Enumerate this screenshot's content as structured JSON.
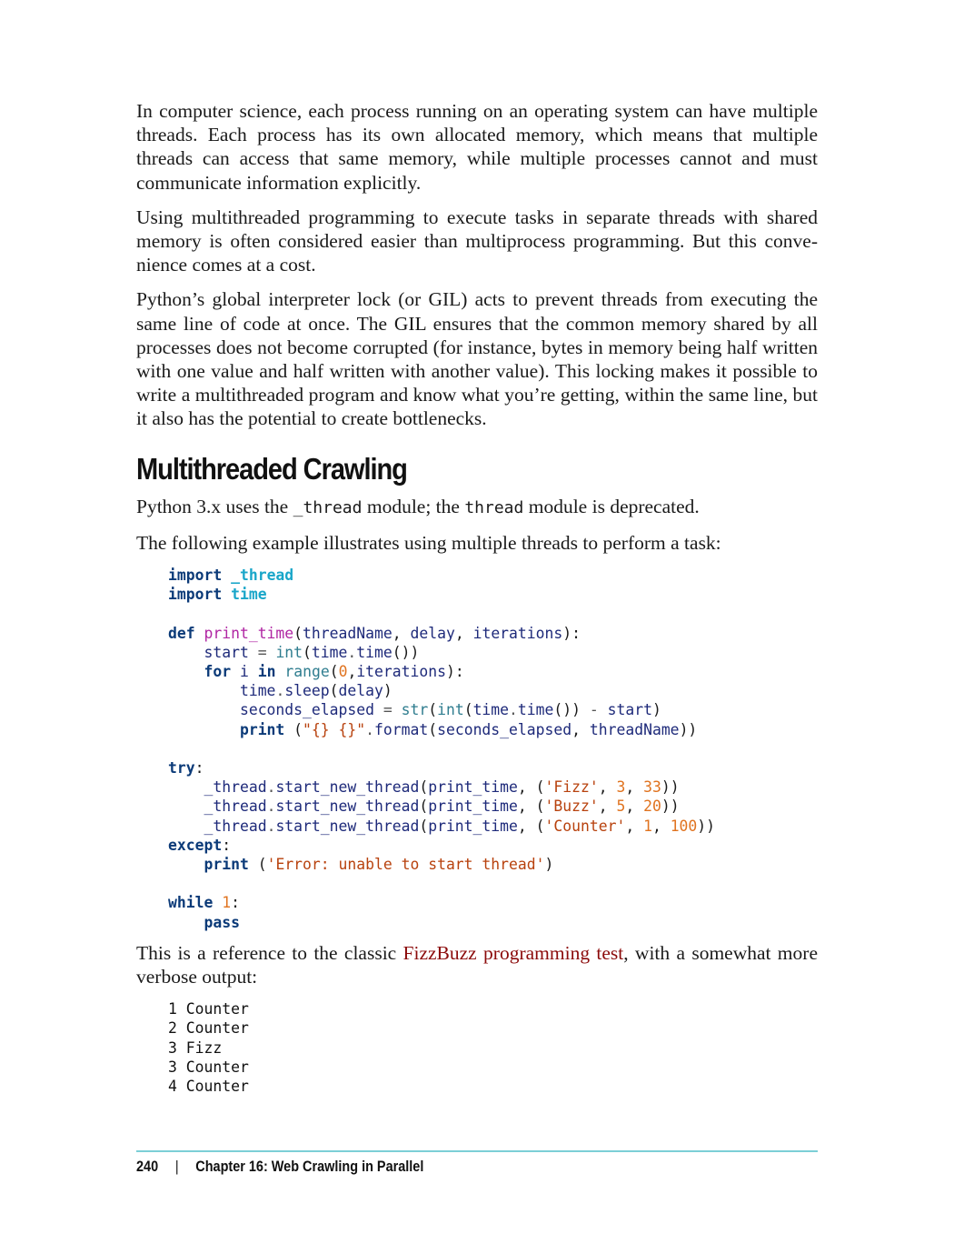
{
  "paragraphs": {
    "p1": "In computer science, each process running on an operating system can have multiple threads. Each process has its own allocated memory, which means that multiple threads can access that same memory, while multiple processes cannot and must communicate information explicitly.",
    "p2": "Using multithreaded programming to execute tasks in separate threads with shared memory is often considered easier than multiprocess programming. But this conve­nience comes at a cost.",
    "p3": "Python’s global interpreter lock (or GIL) acts to prevent threads from executing the same line of code at once. The GIL ensures that the common memory shared by all processes does not become corrupted (for instance, bytes in memory being half writ­ten with one value and half written with another value). This locking makes it possi­ble to write a multithreaded program and know what you’re getting, within the same line, but it also has the potential to create bottlenecks."
  },
  "section": {
    "heading": "Multithreaded Crawling",
    "intro_part1": "Python 3.x uses the ",
    "intro_code1": "_thread",
    "intro_part2": " module; the ",
    "intro_code2": "thread",
    "intro_part3": " module is deprecated.",
    "example_intro": "The following example illustrates using multiple threads to perform a task:"
  },
  "code_lines": [
    [
      {
        "t": "import",
        "c": "kw"
      },
      {
        "t": " ",
        "c": "plain"
      },
      {
        "t": "_thread",
        "c": "mod"
      }
    ],
    [
      {
        "t": "import",
        "c": "kw"
      },
      {
        "t": " ",
        "c": "plain"
      },
      {
        "t": "time",
        "c": "mod"
      }
    ],
    [],
    [
      {
        "t": "def",
        "c": "kw"
      },
      {
        "t": " ",
        "c": "plain"
      },
      {
        "t": "print_time",
        "c": "fn"
      },
      {
        "t": "(",
        "c": "plain"
      },
      {
        "t": "threadName",
        "c": "id"
      },
      {
        "t": ", ",
        "c": "plain"
      },
      {
        "t": "delay",
        "c": "id"
      },
      {
        "t": ", ",
        "c": "plain"
      },
      {
        "t": "iterations",
        "c": "id"
      },
      {
        "t": "):",
        "c": "plain"
      }
    ],
    [
      {
        "t": "    ",
        "c": "plain"
      },
      {
        "t": "start",
        "c": "id"
      },
      {
        "t": " = ",
        "c": "op"
      },
      {
        "t": "int",
        "c": "bi"
      },
      {
        "t": "(",
        "c": "plain"
      },
      {
        "t": "time",
        "c": "id"
      },
      {
        "t": ".",
        "c": "op"
      },
      {
        "t": "time",
        "c": "id"
      },
      {
        "t": "())",
        "c": "plain"
      }
    ],
    [
      {
        "t": "    ",
        "c": "plain"
      },
      {
        "t": "for",
        "c": "kw"
      },
      {
        "t": " ",
        "c": "plain"
      },
      {
        "t": "i",
        "c": "id"
      },
      {
        "t": " ",
        "c": "plain"
      },
      {
        "t": "in",
        "c": "kw"
      },
      {
        "t": " ",
        "c": "plain"
      },
      {
        "t": "range",
        "c": "bi"
      },
      {
        "t": "(",
        "c": "plain"
      },
      {
        "t": "0",
        "c": "num"
      },
      {
        "t": ",",
        "c": "plain"
      },
      {
        "t": "iterations",
        "c": "id"
      },
      {
        "t": "):",
        "c": "plain"
      }
    ],
    [
      {
        "t": "        ",
        "c": "plain"
      },
      {
        "t": "time",
        "c": "id"
      },
      {
        "t": ".",
        "c": "op"
      },
      {
        "t": "sleep",
        "c": "id"
      },
      {
        "t": "(",
        "c": "plain"
      },
      {
        "t": "delay",
        "c": "id"
      },
      {
        "t": ")",
        "c": "plain"
      }
    ],
    [
      {
        "t": "        ",
        "c": "plain"
      },
      {
        "t": "seconds_elapsed",
        "c": "id"
      },
      {
        "t": " = ",
        "c": "op"
      },
      {
        "t": "str",
        "c": "bi"
      },
      {
        "t": "(",
        "c": "plain"
      },
      {
        "t": "int",
        "c": "bi"
      },
      {
        "t": "(",
        "c": "plain"
      },
      {
        "t": "time",
        "c": "id"
      },
      {
        "t": ".",
        "c": "op"
      },
      {
        "t": "time",
        "c": "id"
      },
      {
        "t": "()) ",
        "c": "plain"
      },
      {
        "t": "-",
        "c": "op"
      },
      {
        "t": " ",
        "c": "plain"
      },
      {
        "t": "start",
        "c": "id"
      },
      {
        "t": ")",
        "c": "plain"
      }
    ],
    [
      {
        "t": "        ",
        "c": "plain"
      },
      {
        "t": "print",
        "c": "kw"
      },
      {
        "t": " (",
        "c": "plain"
      },
      {
        "t": "\"{} {}\"",
        "c": "str"
      },
      {
        "t": ".",
        "c": "op"
      },
      {
        "t": "format",
        "c": "id"
      },
      {
        "t": "(",
        "c": "plain"
      },
      {
        "t": "seconds_elapsed",
        "c": "id"
      },
      {
        "t": ", ",
        "c": "plain"
      },
      {
        "t": "threadName",
        "c": "id"
      },
      {
        "t": "))",
        "c": "plain"
      }
    ],
    [],
    [
      {
        "t": "try",
        "c": "kw"
      },
      {
        "t": ":",
        "c": "plain"
      }
    ],
    [
      {
        "t": "    ",
        "c": "plain"
      },
      {
        "t": "_thread",
        "c": "id"
      },
      {
        "t": ".",
        "c": "op"
      },
      {
        "t": "start_new_thread",
        "c": "id"
      },
      {
        "t": "(",
        "c": "plain"
      },
      {
        "t": "print_time",
        "c": "id"
      },
      {
        "t": ", (",
        "c": "plain"
      },
      {
        "t": "'Fizz'",
        "c": "str"
      },
      {
        "t": ", ",
        "c": "plain"
      },
      {
        "t": "3",
        "c": "num"
      },
      {
        "t": ", ",
        "c": "plain"
      },
      {
        "t": "33",
        "c": "num"
      },
      {
        "t": "))",
        "c": "plain"
      }
    ],
    [
      {
        "t": "    ",
        "c": "plain"
      },
      {
        "t": "_thread",
        "c": "id"
      },
      {
        "t": ".",
        "c": "op"
      },
      {
        "t": "start_new_thread",
        "c": "id"
      },
      {
        "t": "(",
        "c": "plain"
      },
      {
        "t": "print_time",
        "c": "id"
      },
      {
        "t": ", (",
        "c": "plain"
      },
      {
        "t": "'Buzz'",
        "c": "str"
      },
      {
        "t": ", ",
        "c": "plain"
      },
      {
        "t": "5",
        "c": "num"
      },
      {
        "t": ", ",
        "c": "plain"
      },
      {
        "t": "20",
        "c": "num"
      },
      {
        "t": "))",
        "c": "plain"
      }
    ],
    [
      {
        "t": "    ",
        "c": "plain"
      },
      {
        "t": "_thread",
        "c": "id"
      },
      {
        "t": ".",
        "c": "op"
      },
      {
        "t": "start_new_thread",
        "c": "id"
      },
      {
        "t": "(",
        "c": "plain"
      },
      {
        "t": "print_time",
        "c": "id"
      },
      {
        "t": ", (",
        "c": "plain"
      },
      {
        "t": "'Counter'",
        "c": "str"
      },
      {
        "t": ", ",
        "c": "plain"
      },
      {
        "t": "1",
        "c": "num"
      },
      {
        "t": ", ",
        "c": "plain"
      },
      {
        "t": "100",
        "c": "num"
      },
      {
        "t": "))",
        "c": "plain"
      }
    ],
    [
      {
        "t": "except",
        "c": "kw"
      },
      {
        "t": ":",
        "c": "plain"
      }
    ],
    [
      {
        "t": "    ",
        "c": "plain"
      },
      {
        "t": "print",
        "c": "kw"
      },
      {
        "t": " (",
        "c": "plain"
      },
      {
        "t": "'Error: unable to start thread'",
        "c": "str"
      },
      {
        "t": ")",
        "c": "plain"
      }
    ],
    [],
    [
      {
        "t": "while",
        "c": "kw"
      },
      {
        "t": " ",
        "c": "plain"
      },
      {
        "t": "1",
        "c": "num"
      },
      {
        "t": ":",
        "c": "plain"
      }
    ],
    [
      {
        "t": "    ",
        "c": "plain"
      },
      {
        "t": "pass",
        "c": "kw"
      }
    ]
  ],
  "reference": {
    "before": "This is a reference to the classic ",
    "link": "FizzBuzz programming test",
    "after": ", with a somewhat more verbose output:"
  },
  "output_lines": [
    "1 Counter",
    "2 Counter",
    "3 Fizz",
    "3 Counter",
    "4 Counter"
  ],
  "footer": {
    "page_number": "240",
    "separator": "|",
    "chapter": "Chapter 16: Web Crawling in Parallel"
  }
}
